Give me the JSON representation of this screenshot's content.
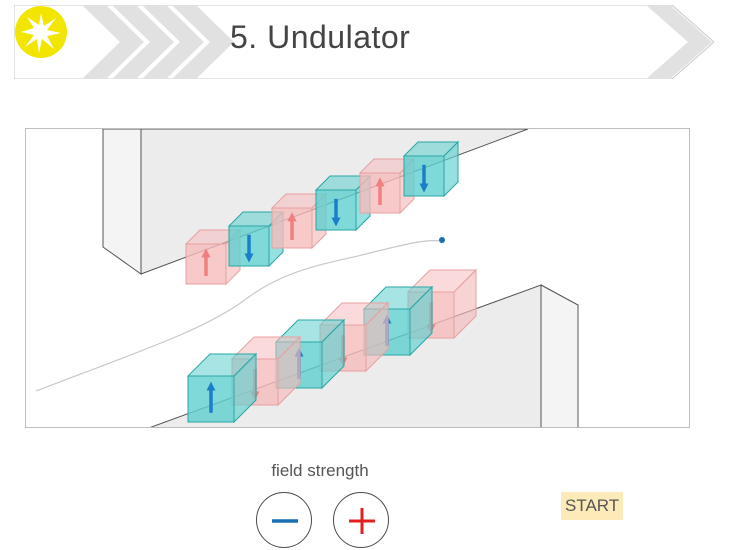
{
  "header": {
    "title": "5. Undulator",
    "logo_icon": "starburst-icon",
    "logo_color": "#f2e600",
    "chevron_color": "#e1e1e1"
  },
  "scene": {
    "top_magnets": [
      "up",
      "down",
      "up",
      "down",
      "up",
      "down"
    ],
    "bottom_magnets": [
      "up",
      "down",
      "up",
      "down",
      "up",
      "down"
    ],
    "colors": {
      "magnet_red": "#f5bcbc",
      "magnet_cyan": "#5fd0d0",
      "arrow_red": "#f08080",
      "arrow_blue": "#1a7fc8",
      "electron": "#1a6fb5"
    }
  },
  "controls": {
    "field_strength_label": "field strength",
    "decrease_icon": "minus-icon",
    "increase_icon": "plus-icon",
    "start_label": "START"
  }
}
